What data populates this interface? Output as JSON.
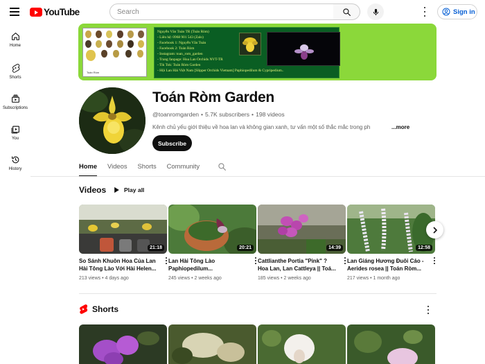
{
  "app": {
    "brand": "YouTube",
    "accent": "#ff0000",
    "link_color": "#065fd4"
  },
  "header": {
    "search_placeholder": "Search",
    "signin_label": "Sign in"
  },
  "sidebar": {
    "items": [
      {
        "label": "Home",
        "icon": "home-icon"
      },
      {
        "label": "Shorts",
        "icon": "shorts-icon"
      },
      {
        "label": "Subscriptions",
        "icon": "subscriptions-icon"
      },
      {
        "label": "You",
        "icon": "you-icon"
      },
      {
        "label": "History",
        "icon": "history-icon"
      }
    ]
  },
  "banner": {
    "lines": [
      "Nguyễn Văn Toán   TR (Toán Ròm)",
      "- Liên hệ: 0968 901 543 (Zalo)",
      "- Facebook 1: Nguyễn Văn Toán",
      "- Facebook 2: Toán Ròm",
      "- Instagram: toan_rom_garden",
      "- Trang fanpage: Hoa Lan Orchids NVT-TR",
      "- Tik Tok: Toán Ròm Garden",
      "- Hội Lan Hài Việt Nam [Slipper Orchids Vietnam] Paphiopedilum & Cypripedium.."
    ],
    "photo_caption": "Toán Ròm"
  },
  "channel": {
    "name": "Toán Ròm Garden",
    "handle": "@toanromgarden",
    "subscribers": "5.7K subscribers",
    "videos_count": "198 videos",
    "separator": "•",
    "description": "Kênh chủ yếu giới thiệu về hoa lan và không gian xanh, tư vấn một số thắc mắc trong ph",
    "more_label": "...more",
    "subscribe_label": "Subscribe"
  },
  "tabs": [
    {
      "label": "Home",
      "active": true
    },
    {
      "label": "Videos",
      "active": false
    },
    {
      "label": "Shorts",
      "active": false
    },
    {
      "label": "Community",
      "active": false
    }
  ],
  "videos_section": {
    "title": "Videos",
    "play_all_label": "Play all",
    "items": [
      {
        "title": "So Sánh Khuôn Hoa Của Lan Hài Tông Lào Với Hài Helen...",
        "views": "213 views",
        "age": "4 days ago",
        "duration": "21:18"
      },
      {
        "title": "Lan Hài Tông Lào Paphiopedilum...",
        "views": "245 views",
        "age": "2 weeks ago",
        "duration": "20:21"
      },
      {
        "title": "Cattlianthe Portia \"Pink\" ? Hoa Lan, Lan Cattleya || Toá...",
        "views": "185 views",
        "age": "2 weeks ago",
        "duration": "14:39"
      },
      {
        "title": "Lan Giáng Hương Đuôi Cáo - Aerides rosea || Toán Ròm...",
        "views": "217 views",
        "age": "1 month ago",
        "duration": "12:58"
      }
    ]
  },
  "shorts_section": {
    "title": "Shorts"
  }
}
